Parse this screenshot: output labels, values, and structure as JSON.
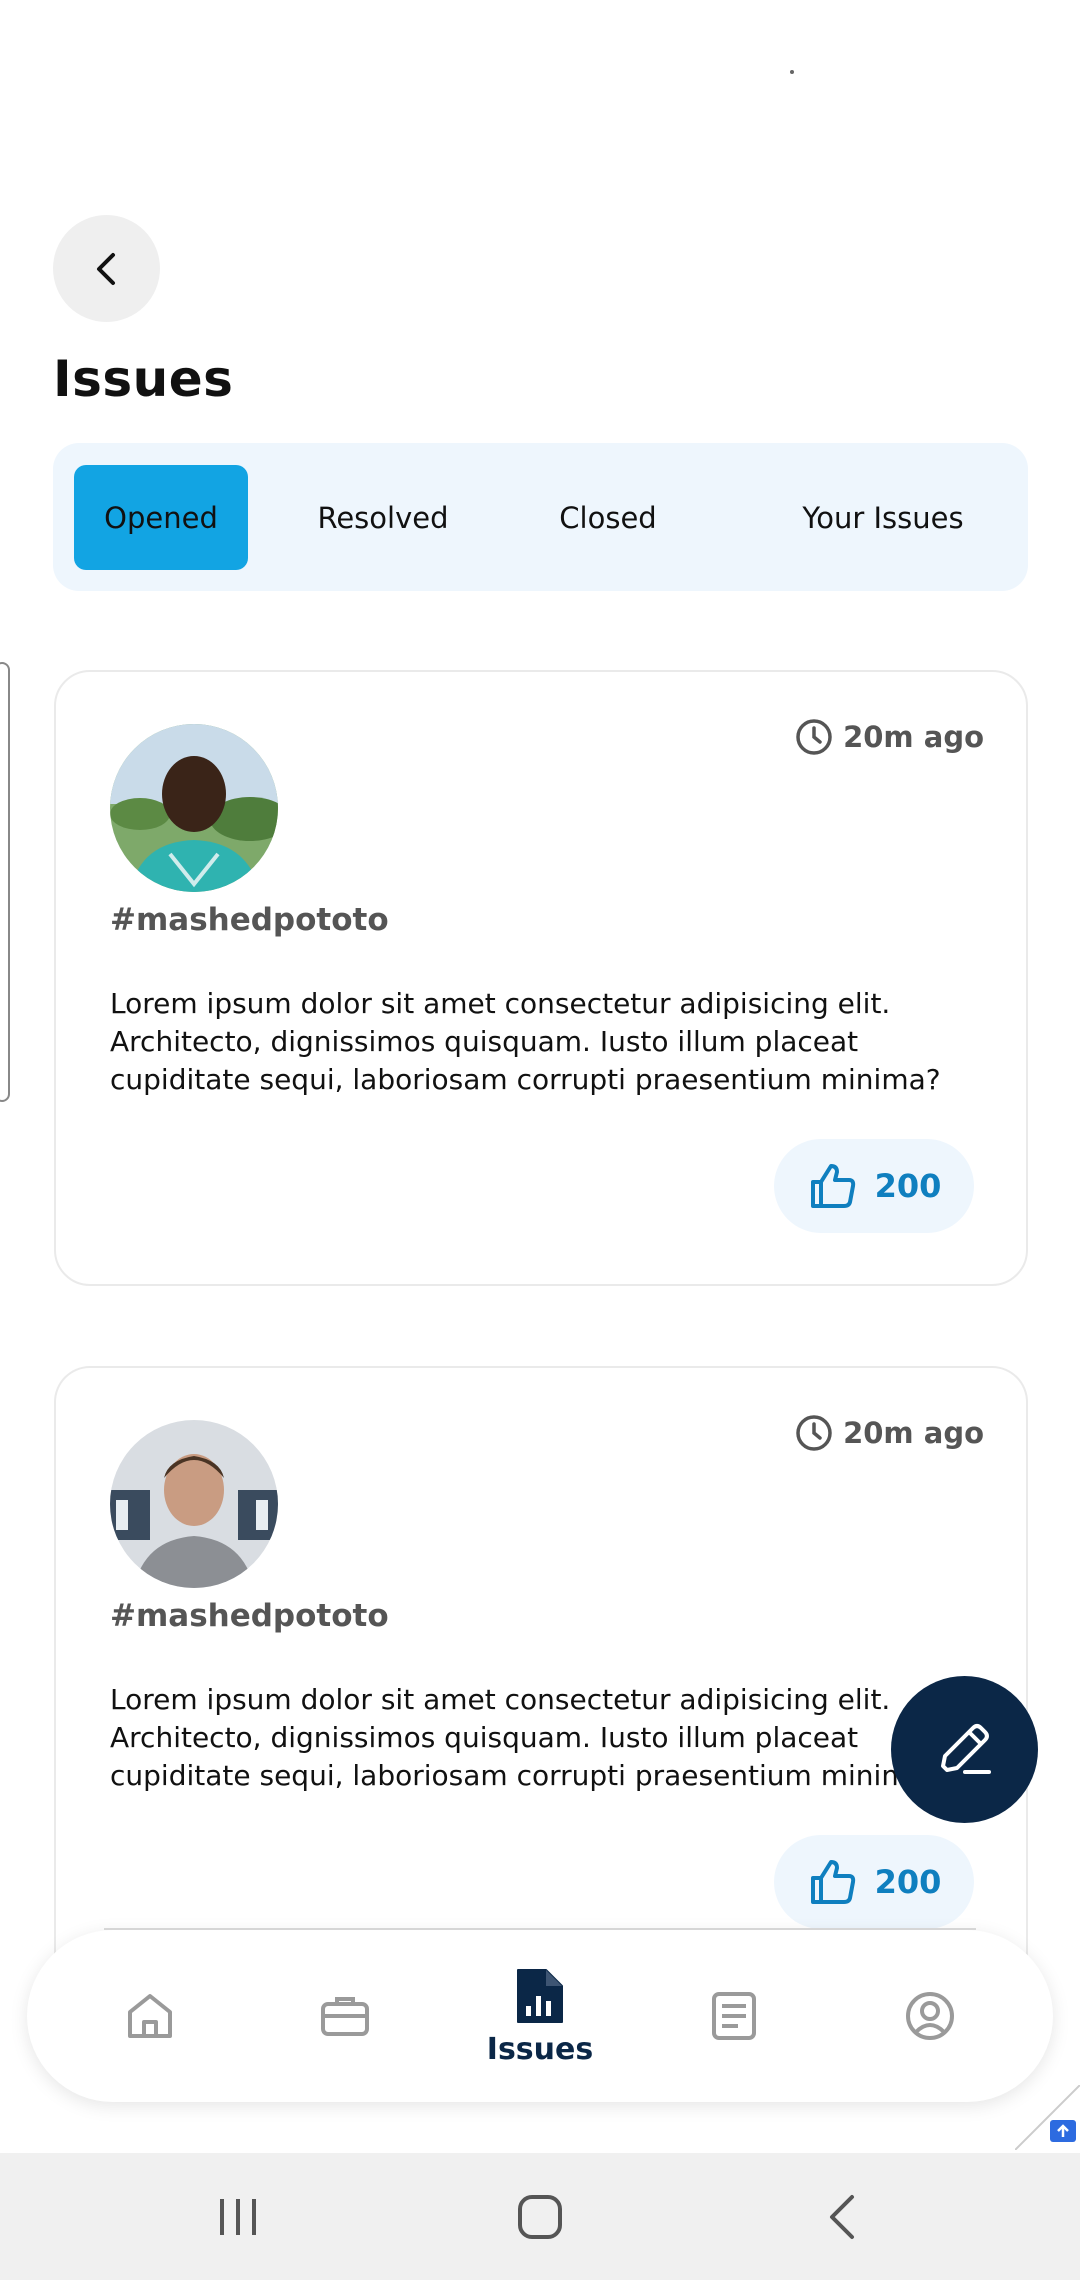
{
  "page": {
    "title": "Issues"
  },
  "tabs": [
    {
      "label": "Opened",
      "active": true
    },
    {
      "label": "Resolved",
      "active": false
    },
    {
      "label": "Closed",
      "active": false
    },
    {
      "label": "Your Issues",
      "active": false
    }
  ],
  "issues": [
    {
      "time": "20m ago",
      "user": "#mashedpototo",
      "body": "Lorem ipsum dolor sit amet consectetur adipisicing elit. Architecto, dignissimos quisquam. Iusto illum placeat cupiditate sequi, laboriosam corrupti praesentium minima?",
      "likes": "200",
      "avatar_icon": "avatar-photo-man"
    },
    {
      "time": "20m ago",
      "user": "#mashedpototo",
      "body": "Lorem ipsum dolor sit amet consectetur adipisicing elit. Architecto, dignissimos quisquam. Iusto illum placeat cupiditate sequi, laboriosam corrupti praesentium minima?",
      "likes": "200",
      "avatar_icon": "avatar-photo-man"
    }
  ],
  "nav": {
    "items": [
      {
        "icon": "home-icon",
        "label": ""
      },
      {
        "icon": "briefcase-icon",
        "label": ""
      },
      {
        "icon": "report-icon",
        "label": "Issues",
        "active": true
      },
      {
        "icon": "document-icon",
        "label": ""
      },
      {
        "icon": "profile-icon",
        "label": ""
      }
    ]
  },
  "colors": {
    "accent": "#12a4e3",
    "navy": "#0b2747",
    "like": "#0f7fbf",
    "tab_bg": "#eef6fd"
  }
}
